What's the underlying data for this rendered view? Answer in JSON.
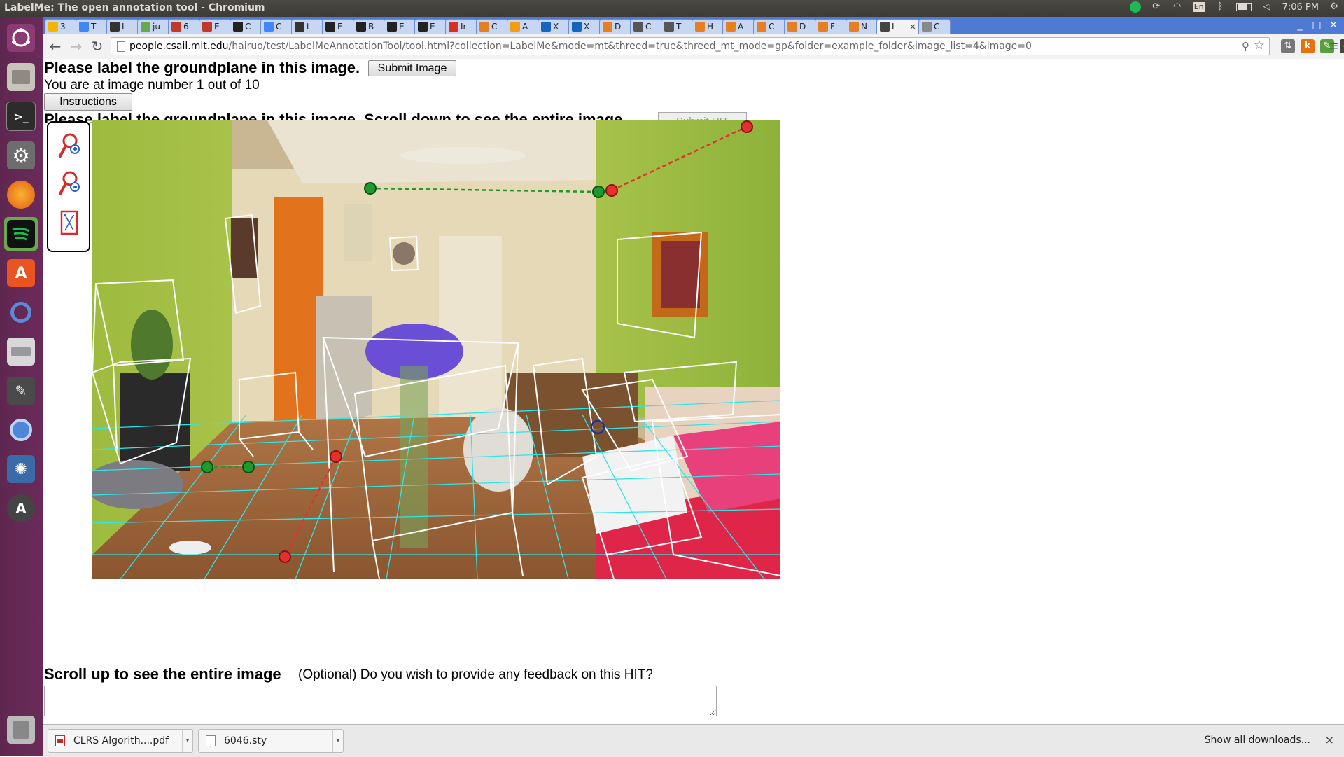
{
  "window": {
    "title": "LabelMe: The open annotation tool - Chromium"
  },
  "system": {
    "time": "7:06 PM",
    "keyboard": "En"
  },
  "tabs": [
    {
      "label": "3",
      "color": "#f4b400"
    },
    {
      "label": "T",
      "color": "#4285f4"
    },
    {
      "label": "L",
      "color": "#333333"
    },
    {
      "label": "ju",
      "color": "#6aa84f"
    },
    {
      "label": "6",
      "color": "#c0392b"
    },
    {
      "label": "E",
      "color": "#c0392b"
    },
    {
      "label": "C",
      "color": "#222222"
    },
    {
      "label": "C",
      "color": "#4285f4"
    },
    {
      "label": "t",
      "color": "#333333"
    },
    {
      "label": "E",
      "color": "#222222"
    },
    {
      "label": "B",
      "color": "#222222"
    },
    {
      "label": "E",
      "color": "#222222"
    },
    {
      "label": "E",
      "color": "#222222"
    },
    {
      "label": "Ir",
      "color": "#d93025"
    },
    {
      "label": "C",
      "color": "#e67e22"
    },
    {
      "label": "A",
      "color": "#f39c12"
    },
    {
      "label": "X",
      "color": "#1565c0"
    },
    {
      "label": "X",
      "color": "#1565c0"
    },
    {
      "label": "D",
      "color": "#e67e22"
    },
    {
      "label": "C",
      "color": "#555555"
    },
    {
      "label": "T",
      "color": "#555555"
    },
    {
      "label": "H",
      "color": "#e67e22"
    },
    {
      "label": "A",
      "color": "#e67e22"
    },
    {
      "label": "C",
      "color": "#e67e22"
    },
    {
      "label": "D",
      "color": "#e67e22"
    },
    {
      "label": "F",
      "color": "#e67e22"
    },
    {
      "label": "N",
      "color": "#e67e22"
    },
    {
      "label": "L",
      "color": "#444444",
      "active": true
    },
    {
      "label": "C",
      "color": "#888888"
    }
  ],
  "toolbar": {
    "url_host": "people.csail.mit.edu",
    "url_path": "/hairuo/test/LabelMeAnnotationTool/tool.html?collection=LabelMe&mode=mt&threed=true&threed_mt_mode=gp&folder=example_folder&image_list=4&image=0",
    "zoom_icon": "magnifier-icon",
    "star_icon": "star-icon",
    "extensions": [
      {
        "name": "extension-1-icon",
        "label": "⇅",
        "color": "#777777"
      },
      {
        "name": "extension-k-icon",
        "label": "k",
        "color": "#e8710a"
      },
      {
        "name": "extension-3-icon",
        "label": "✎",
        "color": "#5a9e3d"
      },
      {
        "name": "pocket-icon",
        "label": "◈",
        "color": "#444444"
      }
    ]
  },
  "page": {
    "heading": "Please label the groundplane in this image.",
    "submit_image": "Submit Image",
    "image_number": "You are at image number 1 out of 10",
    "instructions": "Instructions",
    "heading_clipped": "Please label the groundplane in this image. Scroll down to see the entire image.",
    "submit_hit": "Submit HIT",
    "scroll_up": "Scroll up to see the entire image",
    "feedback_question": "(Optional) Do you wish to provide any feedback on this HIT?",
    "feedback_value": ""
  },
  "zoom_tools": [
    "zoom-in-icon",
    "zoom-out-icon",
    "fit-image-icon"
  ],
  "downloads": [
    {
      "name": "CLRS Algorith....pdf",
      "icon": "pdf-icon"
    },
    {
      "name": "6046.sty",
      "icon": "file-icon"
    }
  ],
  "shelf": {
    "show_all": "Show all downloads...",
    "close": "×"
  }
}
